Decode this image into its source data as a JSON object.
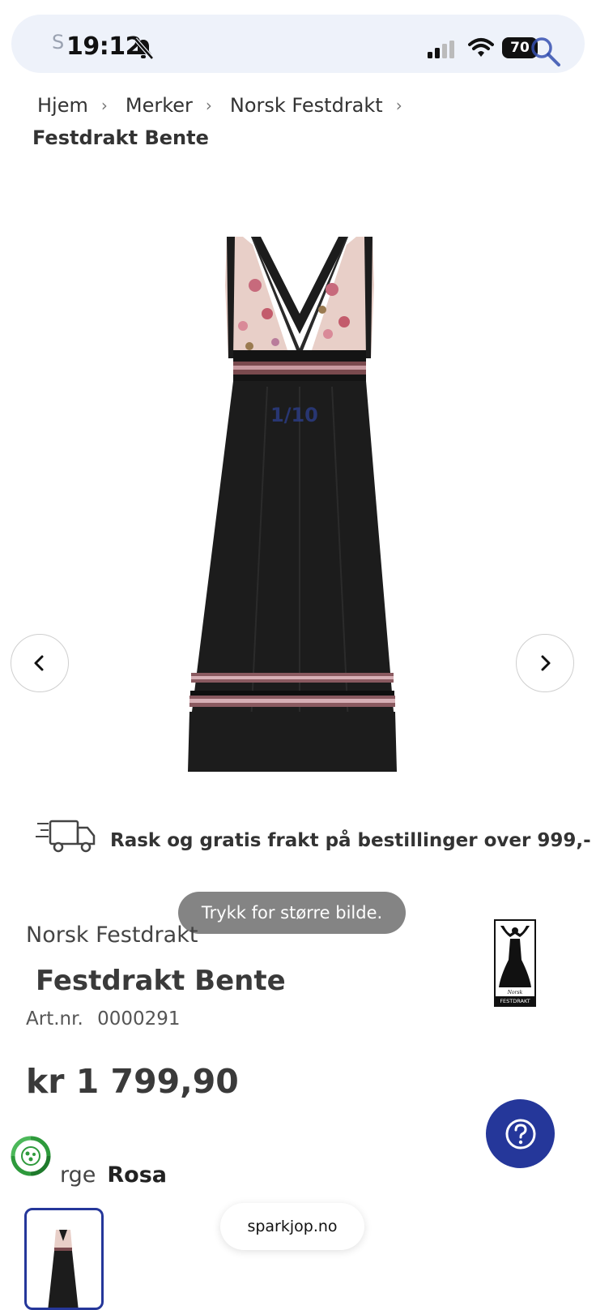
{
  "status_bar": {
    "time": "19:12",
    "battery": "70"
  },
  "search": {
    "placeholder": "S"
  },
  "breadcrumb": {
    "items": [
      "Hjem",
      "Merker",
      "Norsk Festdrakt"
    ],
    "current": "Festdrakt Bente"
  },
  "gallery": {
    "counter": "1/10",
    "zoom_hint": "Trykk for større bilde."
  },
  "shipping": {
    "text": "Rask og gratis frakt på bestillinger over 999,-"
  },
  "product": {
    "brand": "Norsk Festdrakt",
    "title": "Festdrakt Bente",
    "art_label": "Art.nr.",
    "art_number": "0000291",
    "price": "kr 1 799,90",
    "color_label": "rge",
    "color_value": "Rosa"
  },
  "brand_logo": {
    "small_text": "Norsk",
    "band_text": "FESTDRAKT"
  },
  "footer": {
    "domain": "sparkjop.no"
  },
  "colors": {
    "accent": "#25379a",
    "eco_green": "#2e9a3c",
    "dress_black": "#1c1c1c",
    "bodice_pink": "#e8cfc8"
  },
  "icons": [
    "bell-slash-icon",
    "signal-icon",
    "wifi-icon",
    "search-icon",
    "chevron-left-icon",
    "chevron-right-icon",
    "truck-icon",
    "question-icon",
    "eco-icon"
  ]
}
